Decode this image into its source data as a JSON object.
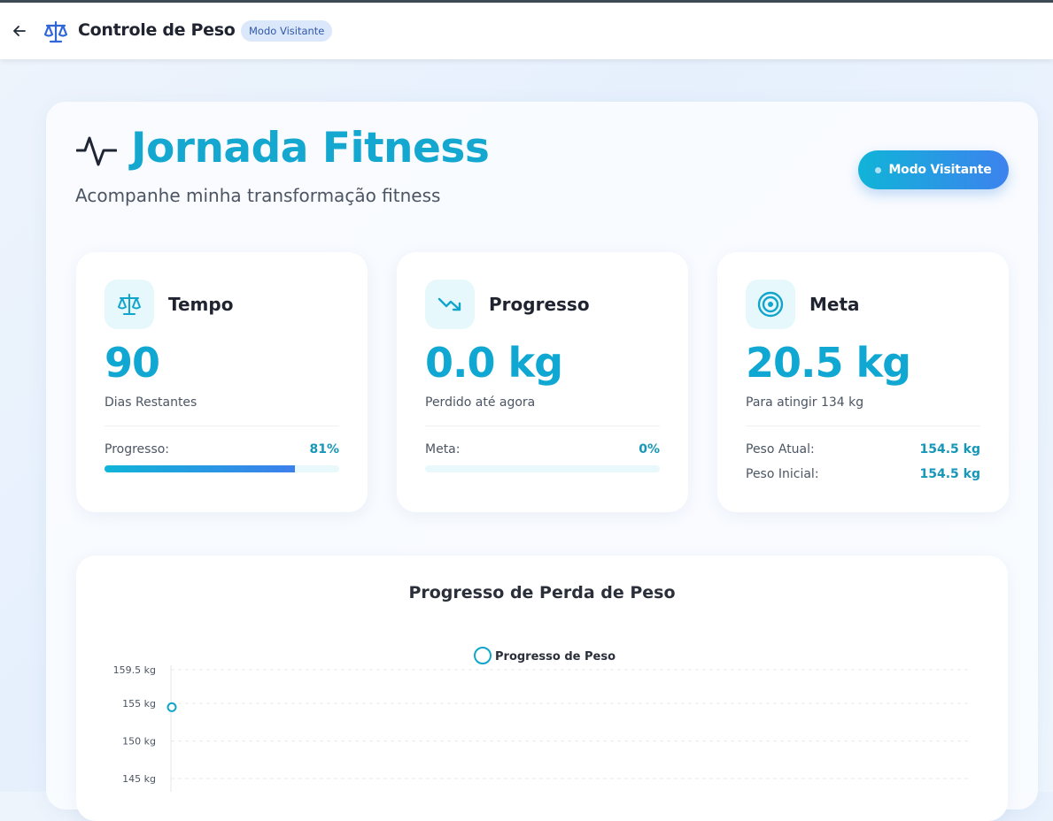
{
  "header": {
    "title": "Controle de Peso",
    "badge": "Modo Visitante"
  },
  "hero": {
    "title": "Jornada Fitness",
    "subtitle": "Acompanhe minha transformação fitness",
    "visitor_button": "Modo Visitante"
  },
  "cards": {
    "tempo": {
      "title": "Tempo",
      "value": "90",
      "caption": "Dias Restantes",
      "progress_label": "Progresso:",
      "progress_text": "81%",
      "progress_fraction": 0.81
    },
    "progresso": {
      "title": "Progresso",
      "value": "0.0 kg",
      "caption": "Perdido até agora",
      "meta_label": "Meta:",
      "meta_text": "0%",
      "meta_fraction": 0
    },
    "meta": {
      "title": "Meta",
      "value": "20.5 kg",
      "caption": "Para atingir 134 kg",
      "rows": [
        {
          "label": "Peso Atual:",
          "value": "154.5 kg"
        },
        {
          "label": "Peso Inicial:",
          "value": "154.5 kg"
        }
      ]
    }
  },
  "colors": {
    "accent": "#10a8d2",
    "gradient_start": "#10b4d8",
    "gradient_end": "#3d82ee"
  },
  "chart_data": {
    "type": "line",
    "title": "Progresso de Perda de Peso",
    "series": [
      {
        "name": "Progresso de Peso",
        "values": [
          154.5
        ]
      }
    ],
    "y_ticks": [
      "159.5 kg",
      "155 kg",
      "150 kg",
      "145 kg"
    ],
    "y_tick_values": [
      159.5,
      155,
      150,
      145
    ],
    "grid": true,
    "legend": "top-center"
  }
}
